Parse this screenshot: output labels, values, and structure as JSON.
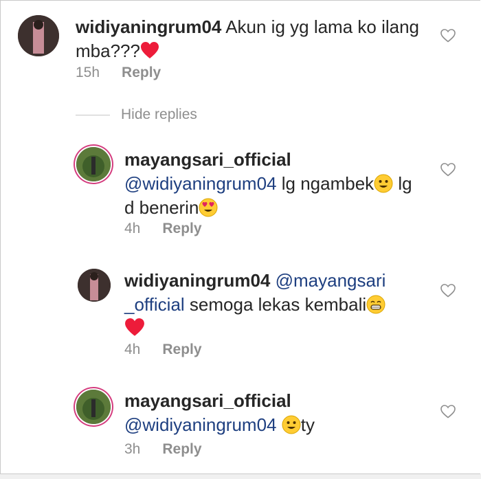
{
  "comments": [
    {
      "username": "widiyaningrum04",
      "mention": "",
      "text_line1": "Akun ig yg lama ko ilang",
      "text_line2": "mba???",
      "emoji_after": "heart",
      "time": "15h",
      "reply_label": "Reply"
    },
    {
      "username": "mayangsari_official",
      "mention": "@widiyaningrum04",
      "text_a": "lg ngambek",
      "text_b": "lg",
      "text_line3": "d benerin",
      "time": "4h",
      "reply_label": "Reply"
    },
    {
      "username": "widiyaningrum04",
      "mention_part1": "@mayangsari",
      "mention_part2": "_official",
      "text": "semoga lekas kembali",
      "time": "4h",
      "reply_label": "Reply"
    },
    {
      "username": "mayangsari_official",
      "mention": "@widiyaningrum04",
      "text": "ty",
      "time": "3h",
      "reply_label": "Reply"
    }
  ],
  "hide_replies_label": "Hide replies",
  "colors": {
    "mention": "#1e3f80",
    "meta": "#8e8e8e",
    "heart_red": "#ed1c3a",
    "story_ring": "#d43c7e"
  },
  "icons": [
    "heart-outline-icon",
    "heart-emoji",
    "smile-emoji",
    "heart-eyes-emoji",
    "grin-emoji"
  ]
}
